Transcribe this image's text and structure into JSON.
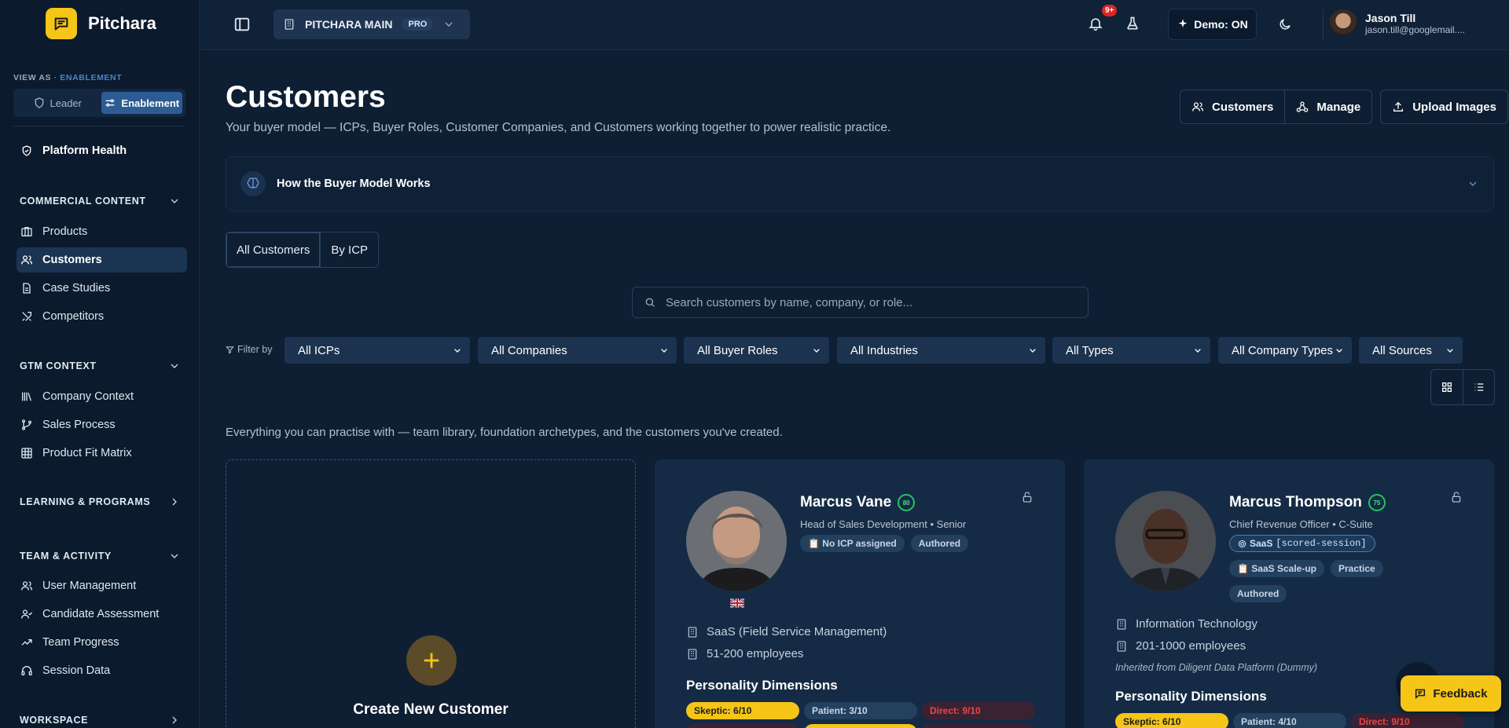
{
  "brand": {
    "name": "Pitchara"
  },
  "sidebar": {
    "view_as_label": "VIEW AS",
    "view_as_value": "· ENABLEMENT",
    "roles": [
      {
        "label": "Leader",
        "active": false
      },
      {
        "label": "Enablement",
        "active": true
      }
    ],
    "platform_health": "Platform Health",
    "sections": [
      {
        "title": "COMMERCIAL CONTENT",
        "expanded": true,
        "items": [
          "Products",
          "Customers",
          "Case Studies",
          "Competitors"
        ]
      },
      {
        "title": "GTM CONTEXT",
        "expanded": true,
        "items": [
          "Company Context",
          "Sales Process",
          "Product Fit Matrix"
        ]
      },
      {
        "title": "LEARNING & PROGRAMS",
        "expanded": false,
        "items": []
      },
      {
        "title": "TEAM & ACTIVITY",
        "expanded": true,
        "items": [
          "User Management",
          "Candidate Assessment",
          "Team Progress",
          "Session Data"
        ]
      },
      {
        "title": "WORKSPACE",
        "expanded": false,
        "items": []
      }
    ],
    "active_item": "Customers"
  },
  "topbar": {
    "workspace_name": "PITCHARA MAIN",
    "workspace_badge": "PRO",
    "notification_count": "9+",
    "demo_label": "Demo: ON",
    "user_name": "Jason Till",
    "user_email": "jason.till@googlemail...."
  },
  "page": {
    "title": "Customers",
    "subtitle": "Your buyer model — ICPs, Buyer Roles, Customer Companies, and Customers working together to power realistic practice.",
    "actions": {
      "customers": "Customers",
      "manage": "Manage",
      "upload": "Upload Images"
    },
    "accordion_title": "How the Buyer Model Works",
    "tabs": [
      "All Customers",
      "By ICP"
    ],
    "search_placeholder": "Search customers by name, company, or role...",
    "filter_label": "Filter by",
    "filters": [
      "All ICPs",
      "All Companies",
      "All Buyer Roles",
      "All Industries",
      "All Types",
      "All Company Types",
      "All Sources"
    ],
    "hint": "Everything you can practise with — team library, foundation archetypes, and the customers you've created.",
    "create_label": "Create New Customer"
  },
  "customers": [
    {
      "name": "Marcus Vane",
      "score": "80",
      "role": "Head of Sales Development • Senior",
      "chips_row1": [
        "📋 No ICP assigned",
        "Authored"
      ],
      "industry": "SaaS (Field Service Management)",
      "size": "51-200 employees",
      "pd_title": "Personality Dimensions",
      "dimensions": [
        "Skeptic: 6/10",
        "Patient: 3/10",
        "Direct: 9/10"
      ]
    },
    {
      "name": "Marcus Thompson",
      "score": "75",
      "role": "Chief Revenue Officer • C-Suite",
      "chip_saas": "SaaS",
      "chip_saas_tag": "[scored-session]",
      "chips_row2": [
        "📋 SaaS Scale-up",
        "Practice"
      ],
      "chips_row3": [
        "Authored"
      ],
      "industry": "Information Technology",
      "size": "201-1000 employees",
      "inherited": "Inherited from Diligent Data Platform (Dummy)",
      "pd_title": "Personality Dimensions",
      "dimensions": [
        "Skeptic: 6/10",
        "Patient: 4/10",
        "Direct: 9/10"
      ]
    }
  ],
  "feedback_label": "Feedback",
  "colors": {
    "accent": "#f5c518",
    "primary": "#2d5c93",
    "background": "#0e1e33"
  }
}
